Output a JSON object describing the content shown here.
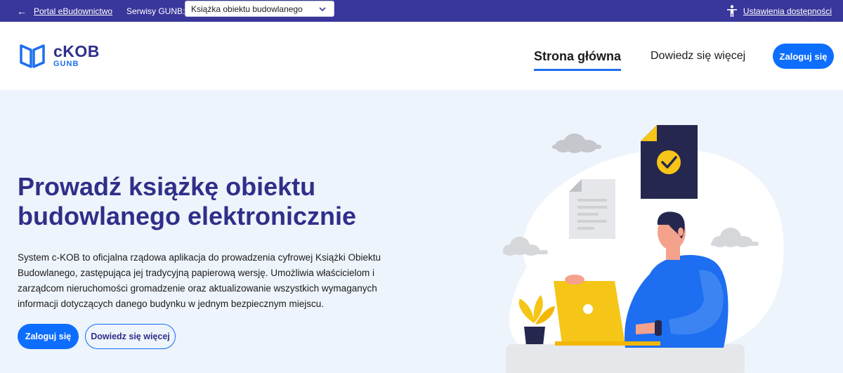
{
  "topbar": {
    "portal_link": "Portal eBudownictwo",
    "services_label": "Serwisy GUNB:",
    "services_selected": "Książka obiektu budowlanego",
    "accessibility_link": "Ustawienia dostępności"
  },
  "header": {
    "logo_main": "cKOB",
    "logo_sub": "GUNB",
    "nav": [
      {
        "label": "Strona główna",
        "active": true
      },
      {
        "label": "Dowiedz się więcej",
        "active": false
      }
    ],
    "login_button": "Zaloguj się"
  },
  "hero": {
    "title": "Prowadź książkę obiektu budowlanego elektronicznie",
    "description": "System c-KOB to oficjalna rządowa aplikacja do prowadzenia cyfrowej Książki Obiektu Budowlanego, zastępująca jej tradycyjną papierową wersję. Umożliwia właścicielom i zarządcom nieruchomości gromadzenie oraz aktualizowanie wszystkich wymaganych informacji dotyczących danego budynku w jednym bezpiecznym miejscu.",
    "primary_button": "Zaloguj się",
    "secondary_button": "Dowiedz się więcej"
  },
  "colors": {
    "topbar_bg": "#39379b",
    "brand_navy": "#2f2f8a",
    "accent_blue": "#0d6efd",
    "hero_bg": "#eef4fb"
  },
  "icons": [
    "back-arrow-icon",
    "chevron-down-icon",
    "accessibility-person-icon",
    "book-logo-icon",
    "checkmark-icon"
  ]
}
